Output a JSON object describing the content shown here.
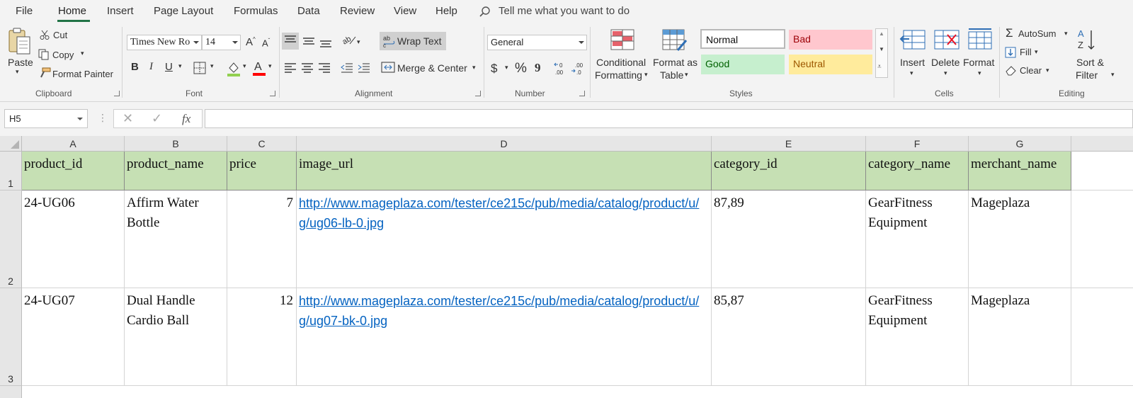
{
  "menu": {
    "tabs": [
      "File",
      "Home",
      "Insert",
      "Page Layout",
      "Formulas",
      "Data",
      "Review",
      "View",
      "Help"
    ],
    "tell_me": "Tell me what you want to do"
  },
  "ribbon": {
    "clipboard": {
      "paste": "Paste",
      "cut": "Cut",
      "copy": "Copy",
      "format_painter": "Format Painter",
      "label": "Clipboard"
    },
    "font": {
      "name": "Times New Ro",
      "size": "14",
      "bold": "B",
      "italic": "I",
      "underline": "U",
      "label": "Font"
    },
    "alignment": {
      "wrap_text": "Wrap Text",
      "merge_center": "Merge & Center",
      "label": "Alignment"
    },
    "number": {
      "format": "General",
      "currency": "$",
      "percent": "%",
      "comma": "9",
      "label": "Number"
    },
    "styles": {
      "conditional": [
        "Conditional",
        "Formatting"
      ],
      "format_table": [
        "Format as",
        "Table"
      ],
      "normal": "Normal",
      "bad": "Bad",
      "good": "Good",
      "neutral": "Neutral",
      "label": "Styles"
    },
    "cells": {
      "insert": "Insert",
      "delete": "Delete",
      "format": "Format",
      "label": "Cells"
    },
    "editing": {
      "autosum": "AutoSum",
      "fill": "Fill",
      "clear": "Clear",
      "sort": [
        "Sort &",
        "Filter"
      ],
      "label": "Editing"
    }
  },
  "formula_bar": {
    "name_box": "H5",
    "fx": "fx",
    "value": ""
  },
  "sheet": {
    "columns": [
      "A",
      "B",
      "C",
      "D",
      "E",
      "F",
      "G"
    ],
    "row_numbers": [
      "1",
      "2",
      "3"
    ],
    "header_row": [
      "product_id",
      "product_name",
      "price",
      "image_url",
      "category_id",
      "category_name",
      "merchant_name"
    ],
    "rows": [
      [
        "24-UG06",
        "Affirm Water Bottle",
        "7",
        "http://www.mageplaza.com/tester/ce215c/pub/media/catalog/product/u/g/ug06-lb-0.jpg",
        "87,89",
        "GearFitness Equipment",
        "Mageplaza"
      ],
      [
        "24-UG07",
        "Dual Handle Cardio Ball",
        "12",
        "http://www.mageplaza.com/tester/ce215c/pub/media/catalog/product/u/g/ug07-bk-0.jpg",
        "85,87",
        "GearFitness Equipment",
        "Mageplaza"
      ]
    ]
  },
  "colors": {
    "accent": "#217346",
    "header_fill": "#c6e0b4",
    "link": "#0563c1"
  }
}
